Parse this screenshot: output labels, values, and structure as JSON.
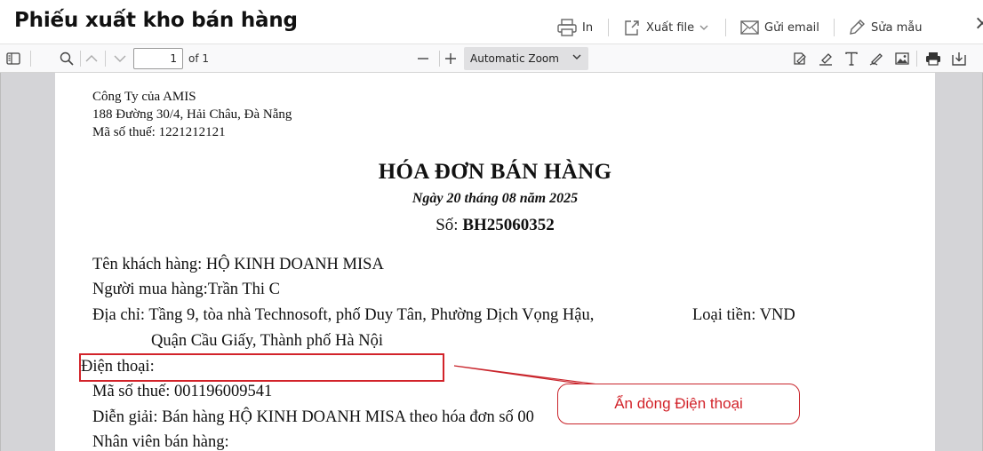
{
  "header": {
    "title": "Phiếu xuất kho bán hàng",
    "actions": {
      "print": "In",
      "export": "Xuất file",
      "email": "Gửi email",
      "edit_template": "Sửa mẫu"
    },
    "close_symbol": "×"
  },
  "pdf_toolbar": {
    "page_number": "1",
    "page_of": "of 1",
    "zoom": "Automatic Zoom",
    "icons": [
      "sidebar-toggle-icon",
      "search-icon",
      "previous-page-icon",
      "next-page-icon",
      "zoom-out-icon",
      "zoom-in-icon",
      "add-signature-icon",
      "highlight-icon",
      "text-icon",
      "draw-icon",
      "image-icon",
      "print-icon",
      "save-icon"
    ]
  },
  "document": {
    "company": {
      "name": "Công Ty của AMIS",
      "address": "188 Đường 30/4, Hải Châu, Đà Nẵng",
      "tax_code": "Mã số thuế: 1221212121"
    },
    "title": "HÓA ĐƠN BÁN HÀNG",
    "date": "Ngày 20 tháng 08 năm 2025",
    "number_label": "Số: ",
    "number_value": "BH25060352",
    "customer": "Tên khách hàng: HỘ KINH DOANH MISA",
    "buyer": "Người mua hàng:Trần Thi C",
    "address_line1": "Địa chỉ: Tầng 9, tòa nhà Technosoft, phố Duy Tân, Phường Dịch Vọng Hậu,",
    "address_line2": "Quận Cầu Giấy, Thành phố Hà Nội",
    "currency": "Loại tiền: VND",
    "phone": "Điện thoại:",
    "tax_code": "Mã số thuế: 001196009541",
    "description": "Diễn giải: Bán hàng HỘ KINH DOANH MISA theo hóa đơn số 00",
    "sales_staff": "Nhân viên bán hàng:"
  },
  "annotation": {
    "callout_text": "Ẩn dòng Điện thoại",
    "color": "#d2232a"
  }
}
